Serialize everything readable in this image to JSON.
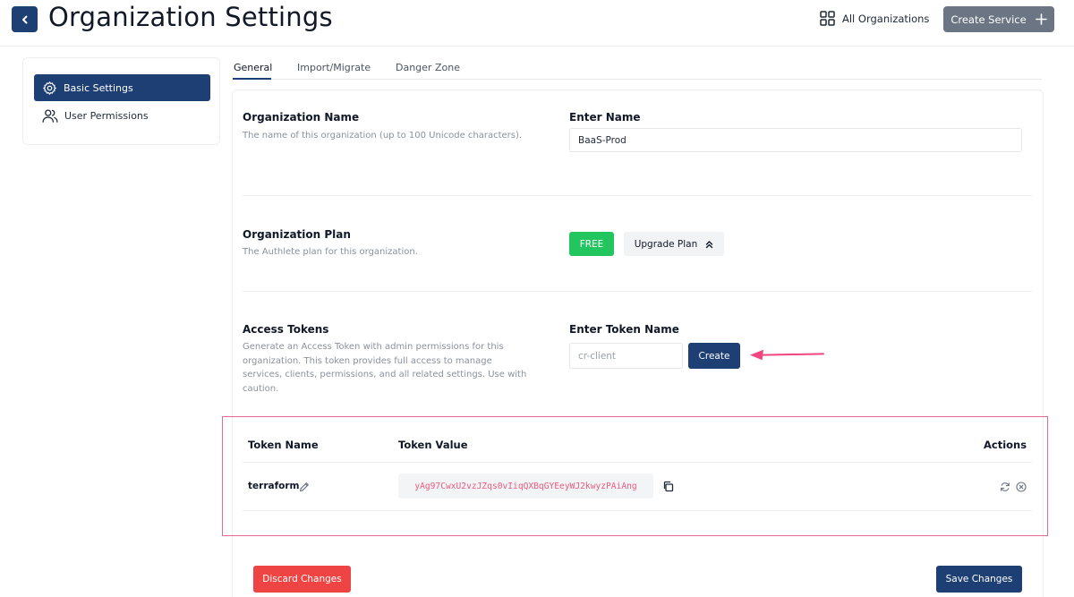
{
  "header": {
    "title": "Organization Settings",
    "all_orgs_label": "All Organizations",
    "create_service_label": "Create Service"
  },
  "sidebar": {
    "items": [
      {
        "label": "Basic Settings",
        "icon": "gear-icon",
        "active": true
      },
      {
        "label": "User Permissions",
        "icon": "users-icon",
        "active": false
      }
    ]
  },
  "tabs": [
    {
      "label": "General",
      "active": true
    },
    {
      "label": "Import/Migrate",
      "active": false
    },
    {
      "label": "Danger Zone",
      "active": false
    }
  ],
  "org_name": {
    "title": "Organization Name",
    "description": "The name of this organization (up to 100 Unicode characters).",
    "field_label": "Enter Name",
    "value": "BaaS-Prod"
  },
  "org_plan": {
    "title": "Organization Plan",
    "description": "The Authlete plan for this organization.",
    "badge": "FREE",
    "upgrade_label": "Upgrade Plan"
  },
  "access_tokens": {
    "title": "Access Tokens",
    "description": "Generate an Access Token with admin permissions for this organization. This token provides full access to manage services, clients, permissions, and all related settings. Use with caution.",
    "field_label": "Enter Token Name",
    "placeholder": "cr-client",
    "create_label": "Create"
  },
  "token_table": {
    "headers": [
      "Token Name",
      "Token Value",
      "Actions"
    ],
    "rows": [
      {
        "name": "terraform",
        "value": "yAg97CwxU2vzJZqs0vIiqQXBqGYEeyWJ2kwyzPAiAng"
      }
    ]
  },
  "footer": {
    "discard_label": "Discard Changes",
    "save_label": "Save Changes"
  },
  "colors": {
    "primary": "#1e3f73",
    "success": "#22c55e",
    "danger": "#ef4444",
    "highlight": "#e76a95",
    "arrow": "#f0457d",
    "token_text": "#ec5b7d"
  }
}
